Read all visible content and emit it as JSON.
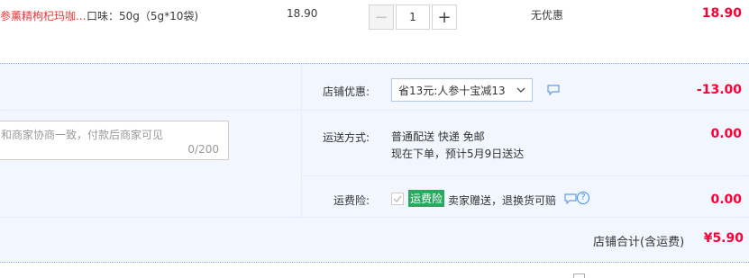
{
  "item": {
    "title": "参薰精枸杞玛咖...",
    "sku": "口味：50g（5g*10袋)",
    "price": "18.90",
    "quantity": "1",
    "discount": "无优惠",
    "total": "18.90",
    "minus_label": "−",
    "plus_label": "+"
  },
  "memo": {
    "placeholder": "和商家协商一致，付款后商家可见",
    "count": "0/200"
  },
  "shop_discount": {
    "label": "店铺优惠:",
    "selected": "省13元:人参十宝减13",
    "amount": "-13.00"
  },
  "shipping": {
    "label": "运送方式:",
    "line1": "普通配送 快递 免邮",
    "line2": "现在下单，预计5月9日送达",
    "amount": "0.00"
  },
  "insurance": {
    "label": "运费险:",
    "badge": "运费险",
    "text": "卖家赠送，退换货可赔",
    "help": "?",
    "amount": "0.00"
  },
  "subtotal": {
    "label": "店铺合计(含运费)",
    "value": "¥5.90"
  },
  "colors": {
    "price_red": "#ff0036",
    "panel_bg": "#f2f7ff",
    "badge_green": "#2aa85e",
    "link_blue": "#3c8cff"
  },
  "icons": [
    "chevron-down-icon",
    "comment-icon",
    "checkmark-icon",
    "help-icon"
  ]
}
